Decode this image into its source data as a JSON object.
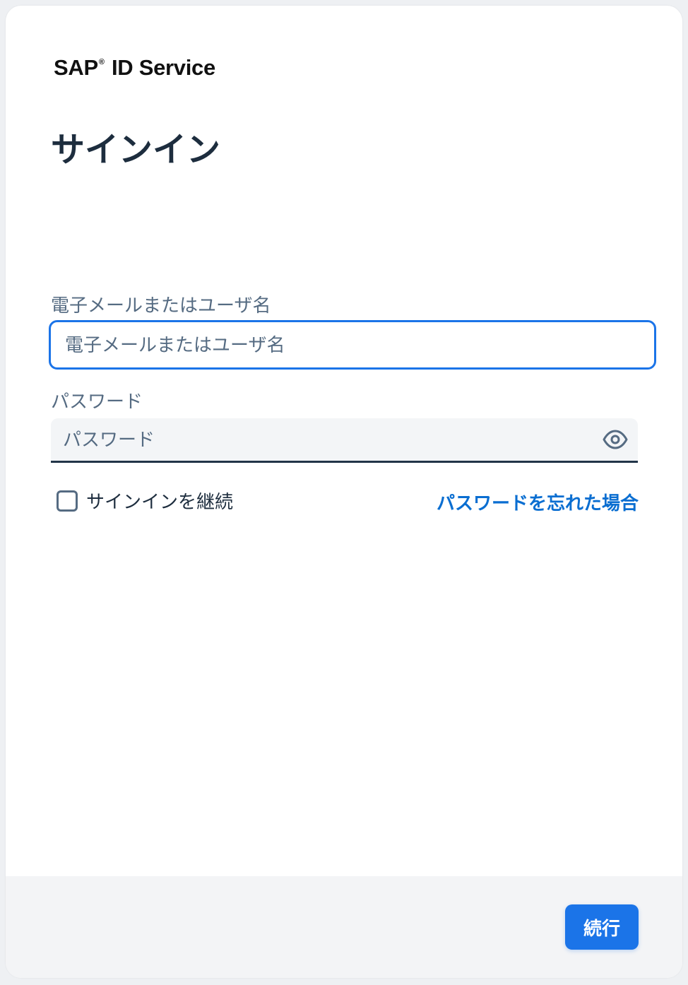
{
  "brand": {
    "name_prefix": "SAP",
    "registered_mark": "®",
    "name_suffix": "ID Service"
  },
  "page_title": "サインイン",
  "email": {
    "label": "電子メールまたはユーザ名",
    "placeholder": "電子メールまたはユーザ名",
    "value": ""
  },
  "password": {
    "label": "パスワード",
    "placeholder": "パスワード",
    "value": "",
    "toggle_icon": "eye-icon"
  },
  "remember": {
    "label": "サインインを継続",
    "checked": false
  },
  "forgot_password_link": "パスワードを忘れた場合",
  "footer": {
    "continue_label": "続行"
  },
  "colors": {
    "accent": "#1b74e8",
    "link": "#0a6ed1",
    "title_text": "#1d2d3e",
    "muted_text": "#556b82",
    "footer_bg": "#f3f4f6"
  }
}
